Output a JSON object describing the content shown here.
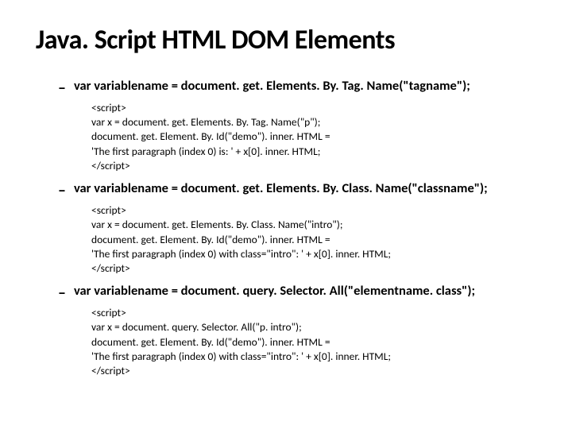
{
  "title": "Java. Script HTML DOM Elements",
  "items": [
    {
      "heading": "var variablename = document. get. Elements. By. Tag. Name(\"tagname\");",
      "code": [
        "<script>",
        "var x = document. get. Elements. By. Tag. Name(\"p\");",
        "document. get. Element. By. Id(\"demo\"). inner. HTML =",
        "'The first paragraph (index 0) is: ' + x[0]. inner. HTML;",
        "</script>"
      ]
    },
    {
      "heading": "var variablename = document. get. Elements. By. Class. Name(\"classname\");",
      "code": [
        "<script>",
        "var x = document. get. Elements. By. Class. Name(\"intro\");",
        "document. get. Element. By. Id(\"demo\"). inner. HTML =",
        "'The first paragraph (index 0) with class=\"intro\": ' + x[0]. inner. HTML;",
        "</script>"
      ]
    },
    {
      "heading": "var variablename = document. query. Selector. All(\"elementname. class\");",
      "code": [
        "<script>",
        "var x = document. query. Selector. All(\"p. intro\");",
        "document. get. Element. By. Id(\"demo\"). inner. HTML =",
        "'The first paragraph (index 0) with class=\"intro\": ' + x[0]. inner. HTML;",
        "</script>"
      ]
    }
  ]
}
